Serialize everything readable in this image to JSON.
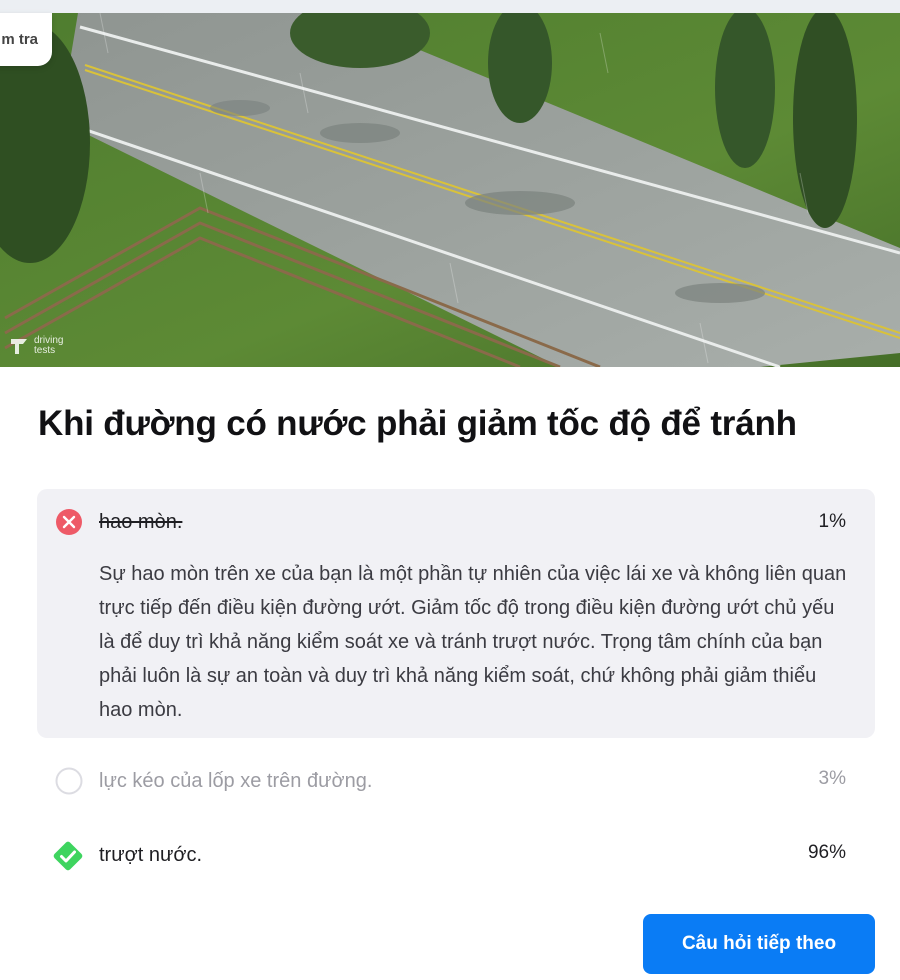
{
  "header": {
    "check_label": "m tra"
  },
  "image": {
    "watermark_text_1": "driving",
    "watermark_text_2": "tests"
  },
  "question": {
    "text": "Khi đường có nước phải giảm tốc độ để tránh"
  },
  "options": [
    {
      "label": "hao mòn.",
      "percent": "1%",
      "status": "incorrect-selected",
      "icon": "x-circle-icon",
      "explanation": "Sự hao mòn trên xe của bạn là một phần tự nhiên của việc lái xe và không liên quan trực tiếp đến điều kiện đường ướt. Giảm tốc độ trong điều kiện đường ướt chủ yếu là để duy trì khả năng kiểm soát xe và tránh trượt nước. Trọng tâm chính của bạn phải luôn là sự an toàn và duy trì khả năng kiểm soát, chứ không phải giảm thiểu hao mòn."
    },
    {
      "label": "lực kéo của lốp xe trên đường.",
      "percent": "3%",
      "status": "unselected",
      "icon": "empty-circle-icon"
    },
    {
      "label": "trượt nước.",
      "percent": "96%",
      "status": "correct",
      "icon": "check-diamond-icon"
    }
  ],
  "next_button": {
    "label": "Câu hỏi tiếp theo"
  },
  "colors": {
    "accent": "#0a7cf5",
    "wrong": "#ee5a67",
    "right": "#3ed45f",
    "answer_bg": "#f1f1f5"
  }
}
